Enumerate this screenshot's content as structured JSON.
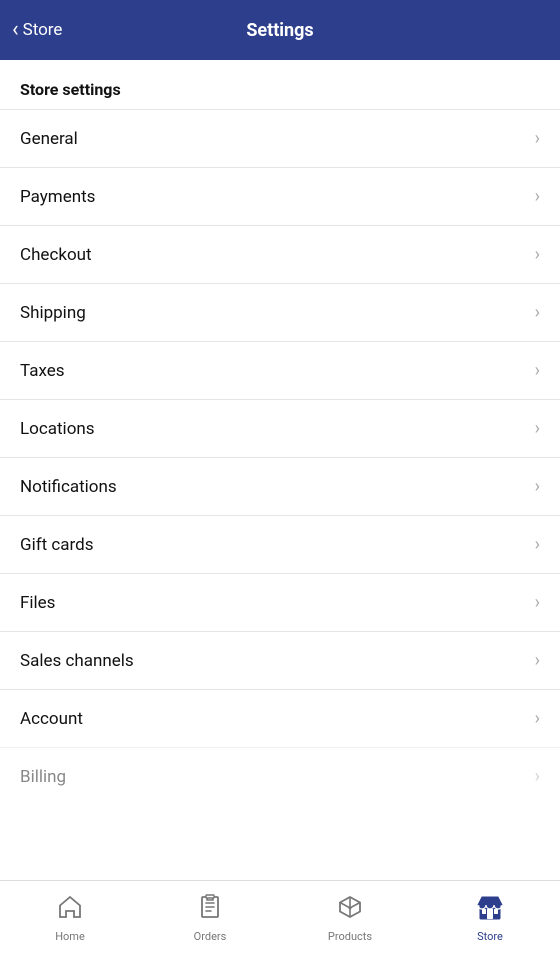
{
  "header": {
    "back_label": "Store",
    "title": "Settings"
  },
  "section": {
    "heading": "Store settings"
  },
  "menu_items": [
    {
      "id": "general",
      "label": "General"
    },
    {
      "id": "payments",
      "label": "Payments"
    },
    {
      "id": "checkout",
      "label": "Checkout"
    },
    {
      "id": "shipping",
      "label": "Shipping"
    },
    {
      "id": "taxes",
      "label": "Taxes"
    },
    {
      "id": "locations",
      "label": "Locations"
    },
    {
      "id": "notifications",
      "label": "Notifications"
    },
    {
      "id": "gift-cards",
      "label": "Gift cards"
    },
    {
      "id": "files",
      "label": "Files"
    },
    {
      "id": "sales-channels",
      "label": "Sales channels"
    },
    {
      "id": "account",
      "label": "Account"
    },
    {
      "id": "billing",
      "label": "Billing"
    }
  ],
  "bottom_nav": {
    "items": [
      {
        "id": "home",
        "label": "Home",
        "icon": "home",
        "active": false
      },
      {
        "id": "orders",
        "label": "Orders",
        "icon": "orders",
        "active": false
      },
      {
        "id": "products",
        "label": "Products",
        "icon": "products",
        "active": false
      },
      {
        "id": "store",
        "label": "Store",
        "icon": "store",
        "active": true
      }
    ]
  },
  "colors": {
    "active": "#2c3e8c",
    "inactive": "#777"
  }
}
